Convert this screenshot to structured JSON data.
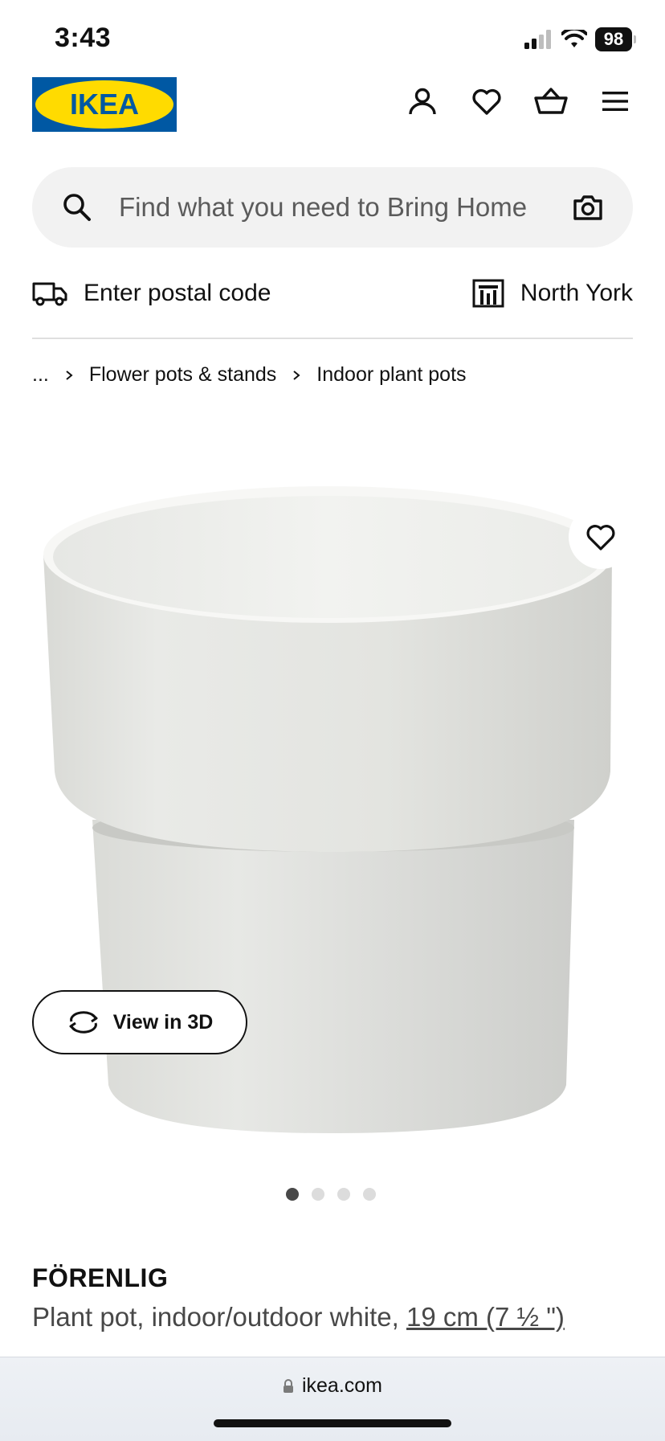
{
  "status_bar": {
    "time": "3:43",
    "battery": "98"
  },
  "header": {
    "logo_text": "IKEA",
    "icons": [
      "profile-icon",
      "heart-icon",
      "basket-icon",
      "menu-icon"
    ]
  },
  "search": {
    "placeholder": "Find what you need to Bring Home"
  },
  "delivery": {
    "postal_label": "Enter postal code",
    "store_label": "North York"
  },
  "breadcrumb": {
    "ellipsis": "...",
    "items": [
      "Flower pots & stands",
      "Indoor plant pots"
    ]
  },
  "product": {
    "view3d_label": "View in 3D",
    "name": "FÖRENLIG",
    "description": "Plant pot, indoor/outdoor white, ",
    "size": "19 cm (7 ½ \")",
    "image_count": 4,
    "active_image_index": 0
  },
  "browser": {
    "url": "ikea.com"
  },
  "colors": {
    "ikea_blue": "#0058A3",
    "ikea_yellow": "#FFDB00",
    "search_bg": "#F2F2F2",
    "text_secondary": "#484848"
  }
}
